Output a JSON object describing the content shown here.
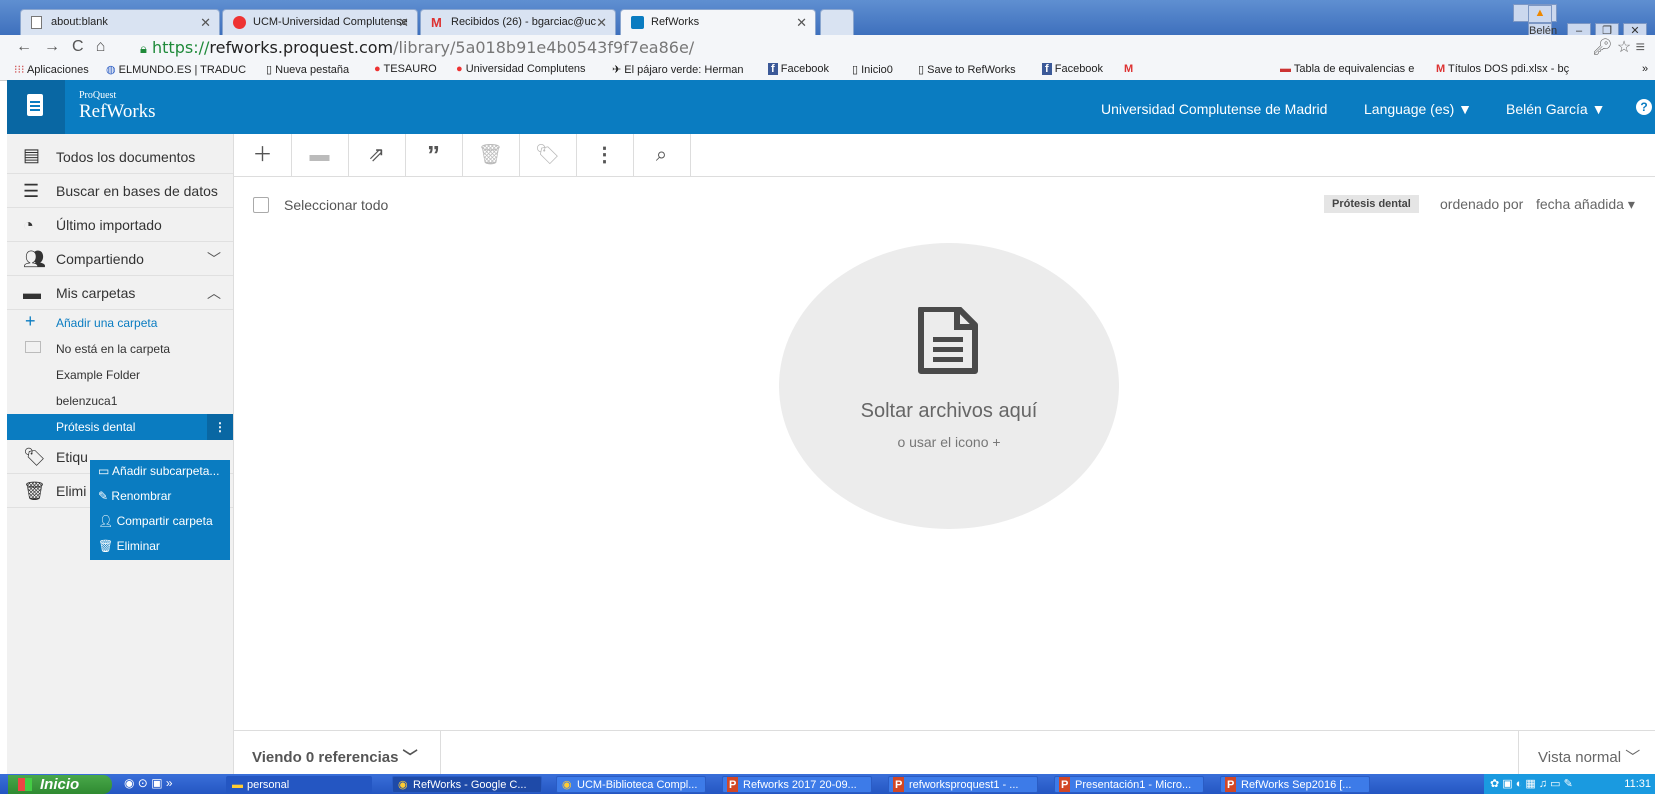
{
  "browser": {
    "tabs": [
      {
        "label": "about:blank"
      },
      {
        "label": "UCM-Universidad Complutense"
      },
      {
        "label": "Recibidos (26) - bgarciac@uc"
      },
      {
        "label": "RefWorks"
      }
    ],
    "user_badge": "Belén",
    "url_protocol": "https://",
    "url_host": "refworks.proquest.com",
    "url_path": "/library/5a018b91e4b0543f9f7ea86e/",
    "bookmarks": [
      "Aplicaciones",
      "ELMUNDO.ES | TRADUC",
      "Nueva pestaña",
      "TESAURO",
      "Universidad Complutens",
      "El pájaro verde: Herman",
      "Facebook",
      "Inicio0",
      "Save to RefWorks",
      "Facebook",
      "Tabla de equivalencias e",
      "Títulos DOS pdi.xlsx - bç",
      "»"
    ]
  },
  "app": {
    "brand_small": "ProQuest",
    "brand_big": "RefWorks",
    "institution": "Universidad Complutense de Madrid",
    "language": "Language (es) ▼",
    "user": "Belén García ▼",
    "help": "?"
  },
  "sidebar": {
    "items": [
      {
        "label": "Todos los documentos"
      },
      {
        "label": "Buscar en bases de datos"
      },
      {
        "label": "Último importado"
      },
      {
        "label": "Compartiendo"
      },
      {
        "label": "Mis carpetas"
      },
      {
        "label": "Etiqu"
      },
      {
        "label": "Elimi"
      }
    ],
    "add_folder": "Añadir una carpeta",
    "folders": [
      {
        "label": "No está en la carpeta"
      },
      {
        "label": "Example Folder"
      },
      {
        "label": "belenzuca1"
      },
      {
        "label": "Prótesis dental"
      }
    ],
    "context_menu": [
      {
        "label": "Añadir subcarpeta..."
      },
      {
        "label": "Renombrar"
      },
      {
        "label": "Compartir carpeta"
      },
      {
        "label": "Eliminar"
      }
    ]
  },
  "toolbar": {
    "icons": [
      "add-icon",
      "folder-icon",
      "share-icon",
      "quote-icon",
      "trash-icon",
      "tag-icon",
      "more-icon",
      "search-icon"
    ]
  },
  "main": {
    "select_all": "Seleccionar todo",
    "folder_pill": "Prótesis dental",
    "sort_by": "ordenado por",
    "sort_field": "fecha añadida ▾",
    "drop_title": "Soltar archivos aquí",
    "drop_sub": "o usar el icono +"
  },
  "footer": {
    "refs_count": "Viendo 0 referencias ﹀",
    "view_mode": "Vista normal ﹀"
  },
  "taskbar": {
    "start": "Inicio",
    "items": [
      "personal",
      "RefWorks - Google C...",
      "UCM-Biblioteca Compl...",
      "Refworks 2017 20-09...",
      "refworksproquest1 - ...",
      "Presentación1 - Micro...",
      "RefWorks Sep2016 [..."
    ],
    "clock": "11:31"
  },
  "colors": {
    "brand_blue": "#0a7cc1",
    "brand_dark": "#0967a3"
  }
}
